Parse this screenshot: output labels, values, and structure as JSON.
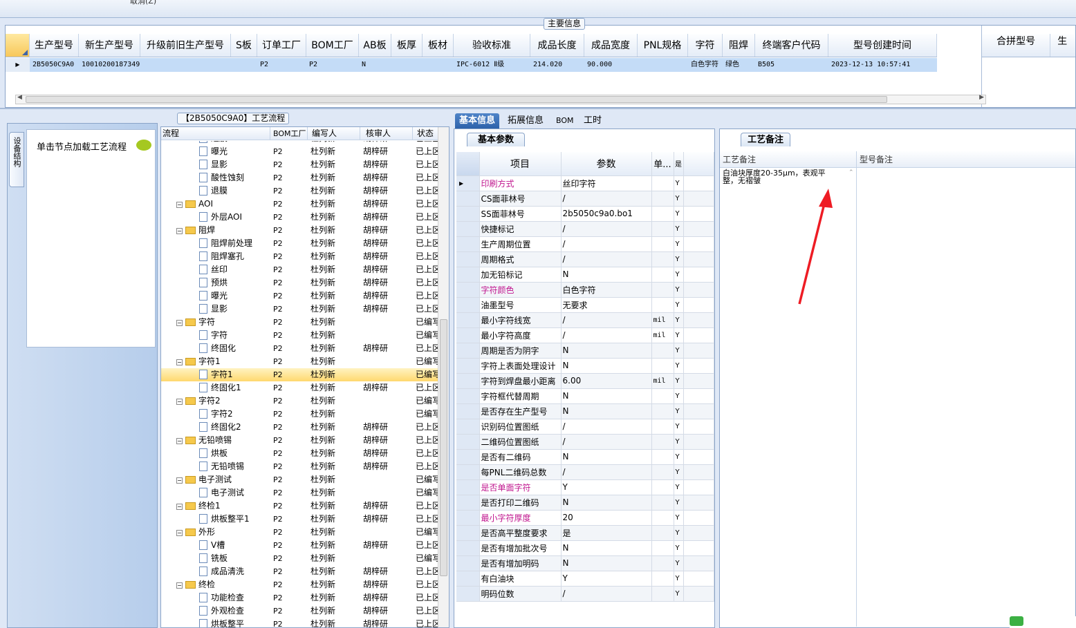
{
  "topbar": {
    "cancel_label": "取消(Z)"
  },
  "main_info": {
    "title": "主要信息",
    "columns": [
      "生产型号",
      "新生产型号",
      "升级前旧生产型号",
      "S板",
      "订单工厂",
      "BOM工厂",
      "AB板",
      "板厚",
      "板材",
      "验收标准",
      "成品长度",
      "成品宽度",
      "PNL规格",
      "字符",
      "阻焊",
      "终端客户代码",
      "型号创建时间"
    ],
    "right_columns": [
      "合拼型号",
      "生"
    ],
    "row": [
      "2B5050C9A0",
      "10010200187349",
      "",
      "",
      "P2",
      "P2",
      "N",
      "",
      "",
      "IPC-6012 Ⅱ级",
      "214.020",
      "90.000",
      "",
      "白色字符",
      "绿色",
      "B505",
      "2023-12-13 10:57:41"
    ]
  },
  "left_panel": {
    "vertical_tab": "设备结构",
    "hint": "单击节点加载工艺流程"
  },
  "process": {
    "title": "【2B5050C9A0】工艺流程",
    "headers": [
      "流程",
      "BOM工厂",
      "编写人",
      "核审人",
      "状态"
    ],
    "rows": [
      {
        "name": "退膜",
        "lvl": 2,
        "type": "file",
        "bom": "P2",
        "writer": "杜列新",
        "reviewer": "胡梓研",
        "status": "已上区"
      },
      {
        "name": "曝光",
        "lvl": 2,
        "type": "file",
        "bom": "P2",
        "writer": "杜列新",
        "reviewer": "胡梓研",
        "status": "已上区"
      },
      {
        "name": "显影",
        "lvl": 2,
        "type": "file",
        "bom": "P2",
        "writer": "杜列新",
        "reviewer": "胡梓研",
        "status": "已上区"
      },
      {
        "name": "酸性蚀刻",
        "lvl": 2,
        "type": "file",
        "bom": "P2",
        "writer": "杜列新",
        "reviewer": "胡梓研",
        "status": "已上区"
      },
      {
        "name": "退膜",
        "lvl": 2,
        "type": "file",
        "bom": "P2",
        "writer": "杜列新",
        "reviewer": "胡梓研",
        "status": "已上区"
      },
      {
        "name": "AOI",
        "lvl": 1,
        "type": "folder",
        "bom": "P2",
        "writer": "杜列新",
        "reviewer": "胡梓研",
        "status": "已上区"
      },
      {
        "name": "外层AOI",
        "lvl": 2,
        "type": "file",
        "bom": "P2",
        "writer": "杜列新",
        "reviewer": "胡梓研",
        "status": "已上区"
      },
      {
        "name": "阻焊",
        "lvl": 1,
        "type": "folder",
        "bom": "P2",
        "writer": "杜列新",
        "reviewer": "胡梓研",
        "status": "已上区"
      },
      {
        "name": "阻焊前处理",
        "lvl": 2,
        "type": "file",
        "bom": "P2",
        "writer": "杜列新",
        "reviewer": "胡梓研",
        "status": "已上区"
      },
      {
        "name": "阻焊塞孔",
        "lvl": 2,
        "type": "file",
        "bom": "P2",
        "writer": "杜列新",
        "reviewer": "胡梓研",
        "status": "已上区"
      },
      {
        "name": "丝印",
        "lvl": 2,
        "type": "file",
        "bom": "P2",
        "writer": "杜列新",
        "reviewer": "胡梓研",
        "status": "已上区"
      },
      {
        "name": "预烘",
        "lvl": 2,
        "type": "file",
        "bom": "P2",
        "writer": "杜列新",
        "reviewer": "胡梓研",
        "status": "已上区"
      },
      {
        "name": "曝光",
        "lvl": 2,
        "type": "file",
        "bom": "P2",
        "writer": "杜列新",
        "reviewer": "胡梓研",
        "status": "已上区"
      },
      {
        "name": "显影",
        "lvl": 2,
        "type": "file",
        "bom": "P2",
        "writer": "杜列新",
        "reviewer": "胡梓研",
        "status": "已上区"
      },
      {
        "name": "字符",
        "lvl": 1,
        "type": "folder",
        "bom": "P2",
        "writer": "杜列新",
        "reviewer": "",
        "status": "已编写"
      },
      {
        "name": "字符",
        "lvl": 2,
        "type": "file",
        "bom": "P2",
        "writer": "杜列新",
        "reviewer": "",
        "status": "已编写"
      },
      {
        "name": "终固化",
        "lvl": 2,
        "type": "file",
        "bom": "P2",
        "writer": "杜列新",
        "reviewer": "胡梓研",
        "status": "已上区"
      },
      {
        "name": "字符1",
        "lvl": 1,
        "type": "folder",
        "bom": "P2",
        "writer": "杜列新",
        "reviewer": "",
        "status": "已编写"
      },
      {
        "name": "字符1",
        "lvl": 2,
        "type": "file",
        "bom": "P2",
        "writer": "杜列新",
        "reviewer": "",
        "status": "已编写",
        "selected": true
      },
      {
        "name": "终固化1",
        "lvl": 2,
        "type": "file",
        "bom": "P2",
        "writer": "杜列新",
        "reviewer": "胡梓研",
        "status": "已上区"
      },
      {
        "name": "字符2",
        "lvl": 1,
        "type": "folder",
        "bom": "P2",
        "writer": "杜列新",
        "reviewer": "",
        "status": "已编写"
      },
      {
        "name": "字符2",
        "lvl": 2,
        "type": "file",
        "bom": "P2",
        "writer": "杜列新",
        "reviewer": "",
        "status": "已编写"
      },
      {
        "name": "终固化2",
        "lvl": 2,
        "type": "file",
        "bom": "P2",
        "writer": "杜列新",
        "reviewer": "胡梓研",
        "status": "已上区"
      },
      {
        "name": "无铅喷锡",
        "lvl": 1,
        "type": "folder",
        "bom": "P2",
        "writer": "杜列新",
        "reviewer": "胡梓研",
        "status": "已上区"
      },
      {
        "name": "烘板",
        "lvl": 2,
        "type": "file",
        "bom": "P2",
        "writer": "杜列新",
        "reviewer": "胡梓研",
        "status": "已上区"
      },
      {
        "name": "无铅喷锡",
        "lvl": 2,
        "type": "file",
        "bom": "P2",
        "writer": "杜列新",
        "reviewer": "胡梓研",
        "status": "已上区"
      },
      {
        "name": "电子测试",
        "lvl": 1,
        "type": "folder",
        "bom": "P2",
        "writer": "杜列新",
        "reviewer": "",
        "status": "已编写"
      },
      {
        "name": "电子测试",
        "lvl": 2,
        "type": "file",
        "bom": "P2",
        "writer": "杜列新",
        "reviewer": "",
        "status": "已编写"
      },
      {
        "name": "终检1",
        "lvl": 1,
        "type": "folder",
        "bom": "P2",
        "writer": "杜列新",
        "reviewer": "胡梓研",
        "status": "已上区"
      },
      {
        "name": "烘板整平1",
        "lvl": 2,
        "type": "file",
        "bom": "P2",
        "writer": "杜列新",
        "reviewer": "胡梓研",
        "status": "已上区"
      },
      {
        "name": "外形",
        "lvl": 1,
        "type": "folder",
        "bom": "P2",
        "writer": "杜列新",
        "reviewer": "",
        "status": "已编写"
      },
      {
        "name": "V槽",
        "lvl": 2,
        "type": "file",
        "bom": "P2",
        "writer": "杜列新",
        "reviewer": "胡梓研",
        "status": "已上区"
      },
      {
        "name": "铣板",
        "lvl": 2,
        "type": "file",
        "bom": "P2",
        "writer": "杜列新",
        "reviewer": "",
        "status": "已编写"
      },
      {
        "name": "成品清洗",
        "lvl": 2,
        "type": "file",
        "bom": "P2",
        "writer": "杜列新",
        "reviewer": "胡梓研",
        "status": "已上区"
      },
      {
        "name": "终检",
        "lvl": 1,
        "type": "folder",
        "bom": "P2",
        "writer": "杜列新",
        "reviewer": "胡梓研",
        "status": "已上区"
      },
      {
        "name": "功能检查",
        "lvl": 2,
        "type": "file",
        "bom": "P2",
        "writer": "杜列新",
        "reviewer": "胡梓研",
        "status": "已上区"
      },
      {
        "name": "外观检查",
        "lvl": 2,
        "type": "file",
        "bom": "P2",
        "writer": "杜列新",
        "reviewer": "胡梓研",
        "status": "已上区"
      },
      {
        "name": "烘板整平",
        "lvl": 2,
        "type": "file",
        "bom": "P2",
        "writer": "杜列新",
        "reviewer": "胡梓研",
        "status": "已上区"
      }
    ]
  },
  "tabs": [
    "基本信息",
    "拓展信息",
    "BOM",
    "工时"
  ],
  "basic_params": {
    "title": "基本参数",
    "headers": [
      "项目",
      "参数",
      "单...",
      "是"
    ],
    "rows": [
      {
        "item": "印刷方式",
        "value": "丝印字符",
        "unit": "",
        "y": "Y",
        "hl": true
      },
      {
        "item": "CS面菲林号",
        "value": "/",
        "unit": "",
        "y": "Y"
      },
      {
        "item": "SS面菲林号",
        "value": "2b5050c9a0.bo1",
        "unit": "",
        "y": "Y"
      },
      {
        "item": "快捷标记",
        "value": "/",
        "unit": "",
        "y": "Y"
      },
      {
        "item": "生产周期位置",
        "value": "/",
        "unit": "",
        "y": "Y"
      },
      {
        "item": "周期格式",
        "value": "/",
        "unit": "",
        "y": "Y"
      },
      {
        "item": "加无铅标记",
        "value": "N",
        "unit": "",
        "y": "Y"
      },
      {
        "item": "字符颜色",
        "value": "白色字符",
        "unit": "",
        "y": "Y",
        "hl": true
      },
      {
        "item": "油墨型号",
        "value": "无要求",
        "unit": "",
        "y": "Y"
      },
      {
        "item": "最小字符线宽",
        "value": "/",
        "unit": "mil",
        "y": "Y"
      },
      {
        "item": "最小字符高度",
        "value": "/",
        "unit": "mil",
        "y": "Y"
      },
      {
        "item": "周期是否为阴字",
        "value": "N",
        "unit": "",
        "y": "Y"
      },
      {
        "item": "字符上表面处理设计",
        "value": "N",
        "unit": "",
        "y": "Y"
      },
      {
        "item": "字符到焊盘最小距离",
        "value": "6.00",
        "unit": "mil",
        "y": "Y"
      },
      {
        "item": "字符框代替周期",
        "value": "N",
        "unit": "",
        "y": "Y"
      },
      {
        "item": "是否存在生产型号",
        "value": "N",
        "unit": "",
        "y": "Y"
      },
      {
        "item": "识别码位置图纸",
        "value": "/",
        "unit": "",
        "y": "Y"
      },
      {
        "item": "二维码位置图纸",
        "value": "/",
        "unit": "",
        "y": "Y"
      },
      {
        "item": "是否有二维码",
        "value": "N",
        "unit": "",
        "y": "Y"
      },
      {
        "item": "每PNL二维码总数",
        "value": "/",
        "unit": "",
        "y": "Y"
      },
      {
        "item": "是否单面字符",
        "value": "Y",
        "unit": "",
        "y": "Y",
        "hl": true
      },
      {
        "item": "是否打印二维码",
        "value": "N",
        "unit": "",
        "y": "Y"
      },
      {
        "item": "最小字符厚度",
        "value": "20",
        "unit": "",
        "y": "Y",
        "hl": true
      },
      {
        "item": "是否高平整度要求",
        "value": "是",
        "unit": "",
        "y": "Y"
      },
      {
        "item": "是否有增加批次号",
        "value": "N",
        "unit": "",
        "y": "Y"
      },
      {
        "item": "是否有增加明码",
        "value": "N",
        "unit": "",
        "y": "Y"
      },
      {
        "item": "有白油块",
        "value": "Y",
        "unit": "",
        "y": "Y"
      },
      {
        "item": "明码位数",
        "value": "/",
        "unit": "",
        "y": "Y"
      }
    ]
  },
  "remarks": {
    "title": "工艺备注",
    "process_header": "工艺备注",
    "model_header": "型号备注",
    "process_text": "白油块厚度20-35μm，表观平整，无褶皱"
  },
  "colors": {
    "accent": "#2d62aa",
    "selection": "#c4dcf7",
    "highlight_item": "#c0158e",
    "arrow": "#ee1c24"
  }
}
